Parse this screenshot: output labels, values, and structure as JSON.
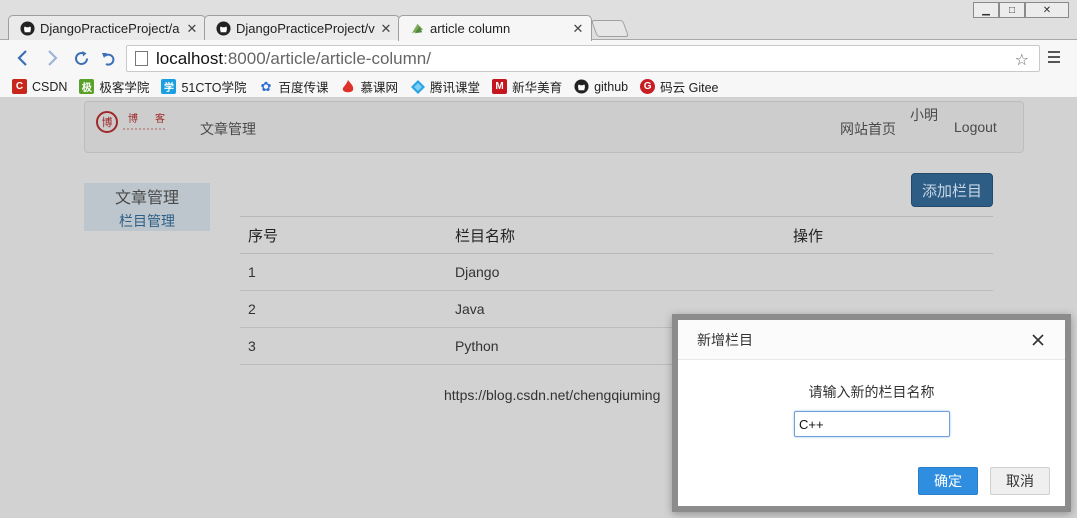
{
  "browser": {
    "tabs": [
      {
        "title": "DjangoPracticeProject/a",
        "icon": "github-icon",
        "active": false
      },
      {
        "title": "DjangoPracticeProject/v",
        "icon": "github-icon",
        "active": false
      },
      {
        "title": "article column",
        "icon": "django-leaf-icon",
        "active": true
      }
    ],
    "address": {
      "host": "localhost",
      "path": ":8000/article/article-column/"
    },
    "bookmarks": [
      {
        "label": "CSDN",
        "icon": "csdn-icon",
        "color": "#c9261b"
      },
      {
        "label": "极客学院",
        "icon": "jikexueyuan-icon",
        "color": "#5aa12a"
      },
      {
        "label": "51CTO学院",
        "icon": "51cto-icon",
        "color": "#1b9fe0"
      },
      {
        "label": "百度传课",
        "icon": "baidu-paw-icon",
        "color": "#2d6fd6"
      },
      {
        "label": "慕课网",
        "icon": "imooc-flame-icon",
        "color": "#e0302b"
      },
      {
        "label": "腾讯课堂",
        "icon": "tencent-classroom-icon",
        "color": "#2aa4e6"
      },
      {
        "label": "新华美育",
        "icon": "xinhua-m-icon",
        "color": "#c4161c"
      },
      {
        "label": "github",
        "icon": "github-icon",
        "color": "#222222"
      },
      {
        "label": "码云 Gitee",
        "icon": "gitee-icon",
        "color": "#c71d23"
      }
    ]
  },
  "navbar": {
    "logo_alt": "博 客",
    "article_manage": "文章管理",
    "home": "网站首页",
    "username": "小明",
    "logout": "Logout"
  },
  "sidebar": {
    "title": "文章管理",
    "item": "栏目管理"
  },
  "main": {
    "add_button": "添加栏目",
    "table": {
      "headers": [
        "序号",
        "栏目名称",
        "操作"
      ],
      "rows": [
        {
          "id": "1",
          "name": "Django"
        },
        {
          "id": "2",
          "name": "Java"
        },
        {
          "id": "3",
          "name": "Python"
        }
      ]
    },
    "footer": "https://blog.csdn.net/chengqiuming"
  },
  "dialog": {
    "title": "新增栏目",
    "prompt": "请输入新的栏目名称",
    "input_value": "C++",
    "ok": "确定",
    "cancel": "取消"
  },
  "colors": {
    "primary": "#2d5c85",
    "dialog_ok": "#2f8ee0"
  }
}
